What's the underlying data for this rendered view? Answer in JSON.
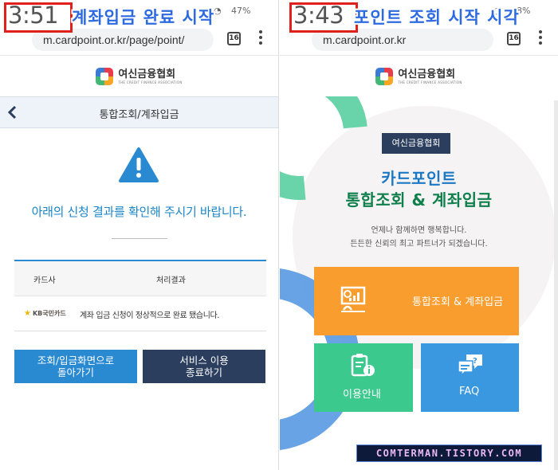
{
  "left": {
    "clock": "3:51",
    "caption": "계좌입금 완료 시작",
    "battery": "47%",
    "url": "m.cardpoint.or.kr/page/point/",
    "tab_count": "16",
    "logo": {
      "ko": "여신금융협회",
      "en": "THE CREDIT FINANCE ASSOCIATION"
    },
    "subheader_title": "통합조회/계좌입금",
    "message": "아래의 신청 결과를 확인해 주시기 바랍니다.",
    "table": {
      "headers": [
        "카드사",
        "처리결과"
      ],
      "rows": [
        {
          "card_company": "KB국민카드",
          "result": "계좌 입금 신청이 정상적으로 완료 됐습니다."
        }
      ]
    },
    "buttons": {
      "back_line1": "조회/입금화면으로",
      "back_line2": "돌아가기",
      "end_line1": "서비스 이용",
      "end_line2": "종료하기"
    },
    "colors": {
      "accent": "#2a8ad1",
      "navy": "#2b3e5e",
      "warning": "#2a8ad1"
    }
  },
  "right": {
    "clock": "3:43",
    "caption": "포인트 조회 시작 시각",
    "battery": "48%",
    "url": "m.cardpoint.or.kr",
    "tab_count": "16",
    "logo": {
      "ko": "여신금융협회",
      "en": "THE CREDIT FINANCE ASSOCIATION"
    },
    "tag": "여신금융협회",
    "hero_line1": "카드포인트",
    "hero_line2": "통합조회 & 계좌입금",
    "tagline_line1": "언제나 함께하면 행복합니다.",
    "tagline_line2": "든든한 신뢰의 최고 파트너가 되겠습니다.",
    "tiles": {
      "main": "통합조회 & 계좌입금",
      "guide": "이용안내",
      "faq": "FAQ"
    },
    "watermark": "COMTERMAN.TISTORY.COM",
    "colors": {
      "orange": "#f99d2e",
      "green": "#3cc98d",
      "blue": "#3a98e0"
    }
  }
}
